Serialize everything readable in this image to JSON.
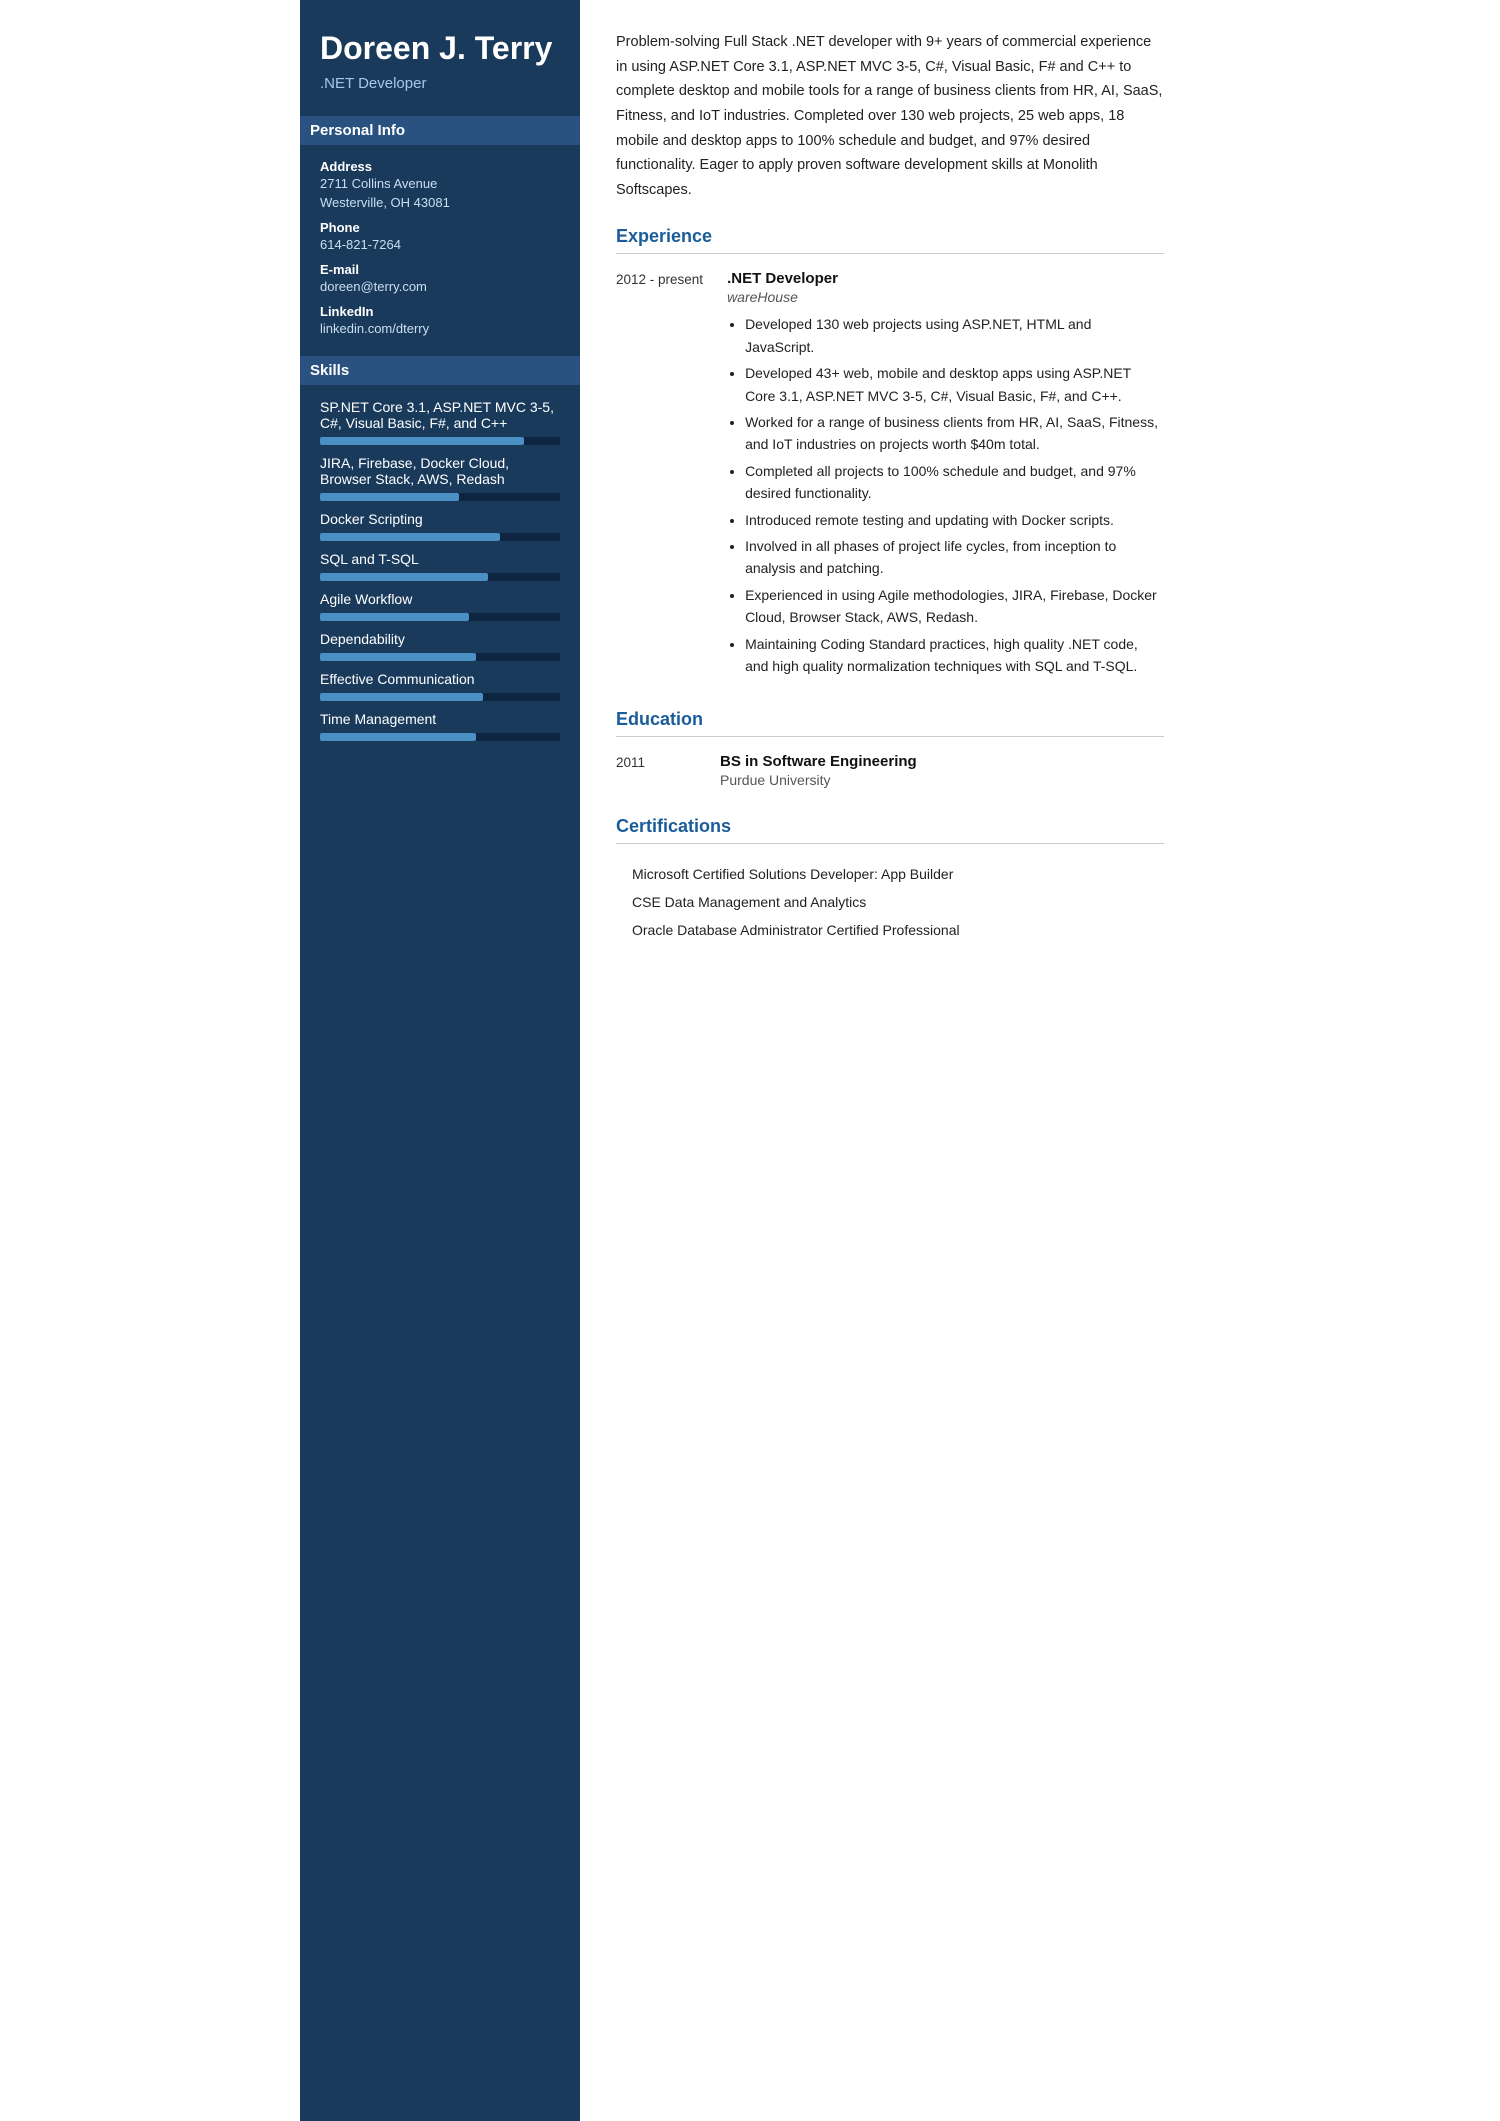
{
  "sidebar": {
    "name": "Doreen J. Terry",
    "title": ".NET Developer",
    "personal_info_label": "Personal Info",
    "address_label": "Address",
    "address_line1": "2711 Collins Avenue",
    "address_line2": "Westerville, OH 43081",
    "phone_label": "Phone",
    "phone_value": "614-821-7264",
    "email_label": "E-mail",
    "email_value": "doreen@terry.com",
    "linkedin_label": "LinkedIn",
    "linkedin_value": "linkedin.com/dterry",
    "skills_label": "Skills",
    "skills": [
      {
        "name": "SP.NET Core 3.1, ASP.NET MVC 3-5, C#, Visual Basic, F#, and C++",
        "percent": 85
      },
      {
        "name": "JIRA, Firebase, Docker Cloud, Browser Stack, AWS, Redash",
        "percent": 58
      },
      {
        "name": "Docker Scripting",
        "percent": 75
      },
      {
        "name": "SQL and T-SQL",
        "percent": 70
      },
      {
        "name": "Agile Workflow",
        "percent": 62
      },
      {
        "name": "Dependability",
        "percent": 65
      },
      {
        "name": "Effective Communication",
        "percent": 68
      },
      {
        "name": "Time Management",
        "percent": 65
      }
    ]
  },
  "main": {
    "summary": "Problem-solving Full Stack .NET developer with 9+ years of commercial experience in using ASP.NET Core 3.1, ASP.NET MVC 3-5, C#, Visual Basic, F# and C++ to complete desktop and mobile tools for a range of business clients from HR, AI, SaaS, Fitness, and IoT industries. Completed over 130 web projects, 25 web apps, 18 mobile and desktop apps to 100% schedule and budget, and 97% desired functionality. Eager to apply proven software development skills at Monolith Softscapes.",
    "experience_title": "Experience",
    "experiences": [
      {
        "date": "2012 - present",
        "job_title": ".NET Developer",
        "company": "wareHouse",
        "bullets": [
          "Developed 130 web projects using ASP.NET, HTML and JavaScript.",
          "Developed 43+ web, mobile and desktop apps using ASP.NET Core 3.1, ASP.NET MVC 3-5, C#, Visual Basic, F#, and C++.",
          "Worked for a range of business clients from HR, AI, SaaS, Fitness, and IoT industries on projects worth $40m total.",
          "Completed all projects to 100% schedule and budget, and 97% desired functionality.",
          "Introduced remote testing and updating with Docker scripts.",
          "Involved in all phases of project life cycles, from inception to analysis and patching.",
          "Experienced in using Agile methodologies, JIRA, Firebase, Docker Cloud, Browser Stack, AWS, Redash.",
          "Maintaining Coding Standard practices, high quality .NET code, and high quality normalization techniques with SQL and T-SQL."
        ]
      }
    ],
    "education_title": "Education",
    "education": [
      {
        "date": "2011",
        "degree": "BS in Software Engineering",
        "school": "Purdue University"
      }
    ],
    "certifications_title": "Certifications",
    "certifications": [
      "Microsoft Certified Solutions Developer: App Builder",
      "CSE Data Management and Analytics",
      "Oracle Database Administrator Certified Professional"
    ]
  }
}
